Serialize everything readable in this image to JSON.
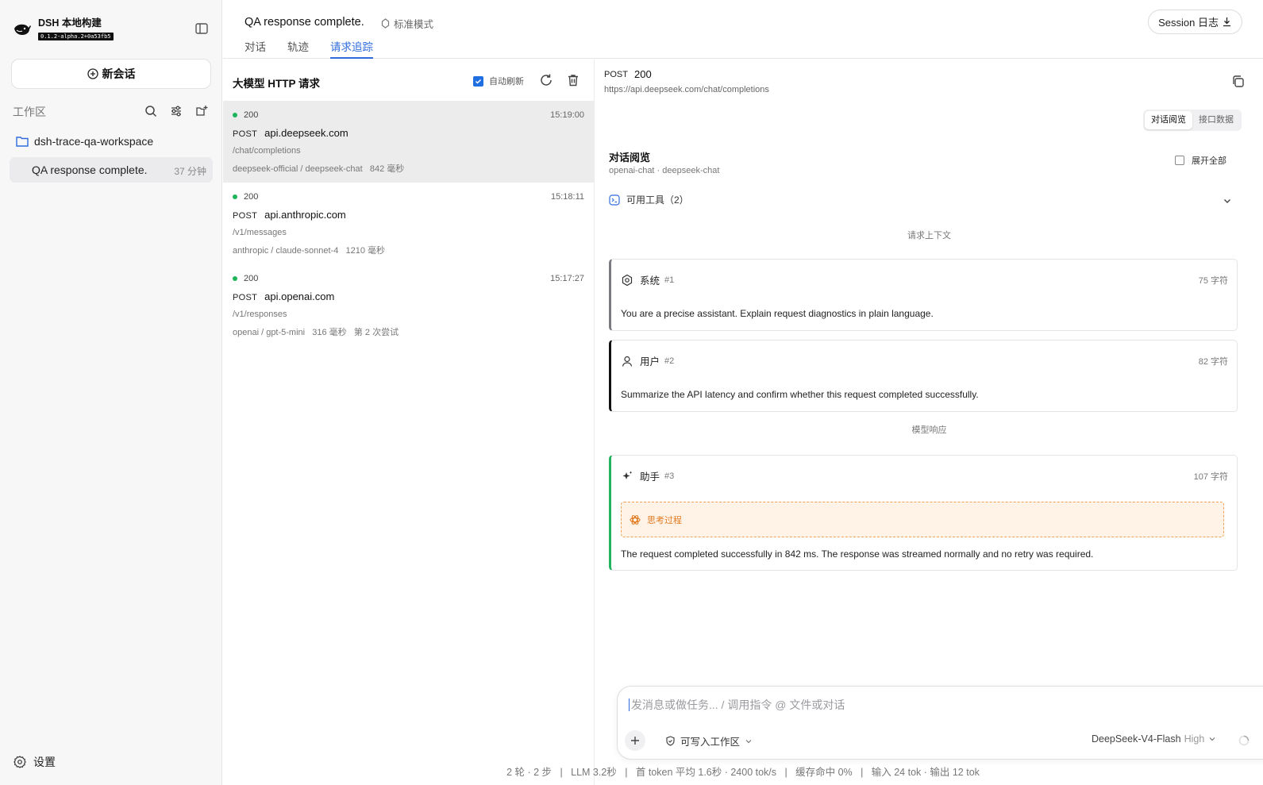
{
  "app": {
    "name": "DSH 本地构建",
    "version": "0.1.2-alpha.2+0a53fb5"
  },
  "sidebar": {
    "new_chat": "新会话",
    "workspace_label": "工作区",
    "folder": "dsh-trace-qa-workspace",
    "session": {
      "title": "QA response complete.",
      "age": "37 分钟"
    },
    "settings": "设置"
  },
  "header": {
    "title": "QA response complete.",
    "mode": "标准模式",
    "tabs": [
      "对话",
      "轨迹",
      "请求追踪"
    ],
    "active_tab": 2,
    "session_log": "Session 日志"
  },
  "requests": {
    "heading": "大模型 HTTP 请求",
    "auto_refresh": "自动刷新",
    "items": [
      {
        "status": "200",
        "time": "15:19:00",
        "method": "POST",
        "host": "api.deepseek.com",
        "path": "/chat/completions",
        "meta": "deepseek-official / deepseek-chat   842 毫秒"
      },
      {
        "status": "200",
        "time": "15:18:11",
        "method": "POST",
        "host": "api.anthropic.com",
        "path": "/v1/messages",
        "meta": "anthropic / claude-sonnet-4   1210 毫秒"
      },
      {
        "status": "200",
        "time": "15:17:27",
        "method": "POST",
        "host": "api.openai.com",
        "path": "/v1/responses",
        "meta": "openai / gpt-5-mini   316 毫秒   第 2 次尝试"
      }
    ]
  },
  "detail": {
    "method": "POST",
    "code": "200",
    "url": "https://api.deepseek.com/chat/completions",
    "seg": [
      "对话阅览",
      "接口数据"
    ],
    "conv_title": "对话阅览",
    "conv_sub": "openai-chat · deepseek-chat",
    "expand_all": "展开全部",
    "tools": "可用工具（2）",
    "ctx_label": "请求上下文",
    "resp_label": "模型响应",
    "messages": [
      {
        "role": "系统",
        "idx": "#1",
        "count": "75 字符",
        "text": "You are a precise assistant. Explain request diagnostics in plain language."
      },
      {
        "role": "用户",
        "idx": "#2",
        "count": "82 字符",
        "text": "Summarize the API latency and confirm whether this request completed successfully."
      },
      {
        "role": "助手",
        "idx": "#3",
        "count": "107 字符",
        "thinking": "思考过程",
        "text": "The request completed successfully in 842 ms. The response was streamed normally and no retry was required."
      }
    ]
  },
  "composer": {
    "placeholder": "发消息或做任务... / 调用指令 @ 文件或对话",
    "permission": "可写入工作区",
    "model": "DeepSeek-V4-Flash",
    "level": "High"
  },
  "footer": "2 轮 · 2 步   |   LLM 3.2秒   |   首 token 平均 1.6秒 · 2400 tok/s   |   缓存命中 0%   |   输入 24 tok · 输出 12 tok",
  "colors": {
    "accent": "#2f6bdc",
    "success": "#1fb35a",
    "thinking": "#e07a1f"
  }
}
